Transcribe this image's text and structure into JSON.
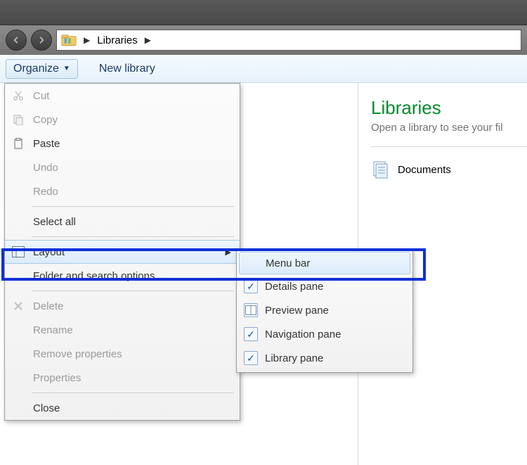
{
  "address": {
    "crumb": "Libraries"
  },
  "toolbar": {
    "organize": "Organize",
    "newlibrary": "New library"
  },
  "rightpane": {
    "title": "Libraries",
    "subtitle": "Open a library to see your fil",
    "documents": "Documents"
  },
  "menu": {
    "cut": "Cut",
    "copy": "Copy",
    "paste": "Paste",
    "undo": "Undo",
    "redo": "Redo",
    "selectall": "Select all",
    "layout": "Layout",
    "folderopts": "Folder and search options",
    "delete": "Delete",
    "rename": "Rename",
    "removeprops": "Remove properties",
    "properties": "Properties",
    "close": "Close"
  },
  "submenu": {
    "menubar": "Menu bar",
    "details": "Details pane",
    "preview": "Preview pane",
    "navigation": "Navigation pane",
    "library": "Library pane"
  }
}
